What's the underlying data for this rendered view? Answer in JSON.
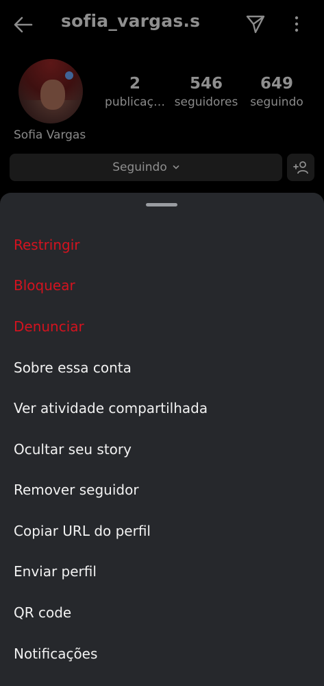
{
  "header": {
    "username": "sofia_vargas.s"
  },
  "profile": {
    "full_name": "Sofia Vargas",
    "stats": [
      {
        "value": "2",
        "label": "publicaç…"
      },
      {
        "value": "546",
        "label": "seguidores"
      },
      {
        "value": "649",
        "label": "seguindo"
      }
    ],
    "following_button_label": "Seguindo"
  },
  "sheet": {
    "items": [
      {
        "label": "Restringir",
        "style": "danger"
      },
      {
        "label": "Bloquear",
        "style": "danger"
      },
      {
        "label": "Denunciar",
        "style": "danger"
      },
      {
        "label": "Sobre essa conta",
        "style": "normal"
      },
      {
        "label": "Ver atividade compartilhada",
        "style": "normal"
      },
      {
        "label": "Ocultar seu story",
        "style": "normal"
      },
      {
        "label": "Remover seguidor",
        "style": "normal"
      },
      {
        "label": "Copiar URL do perfil",
        "style": "normal"
      },
      {
        "label": "Enviar perfil",
        "style": "normal"
      },
      {
        "label": "QR code",
        "style": "normal"
      },
      {
        "label": "Notificações",
        "style": "normal"
      }
    ]
  },
  "colors": {
    "sheet_background": "#26282c",
    "danger_text": "#d4131f",
    "normal_text": "#f2f2f2",
    "overlay_background": "#000000"
  },
  "icons": [
    "back-arrow-icon",
    "send-icon",
    "more-vertical-icon",
    "chevron-down-icon",
    "add-person-icon"
  ]
}
